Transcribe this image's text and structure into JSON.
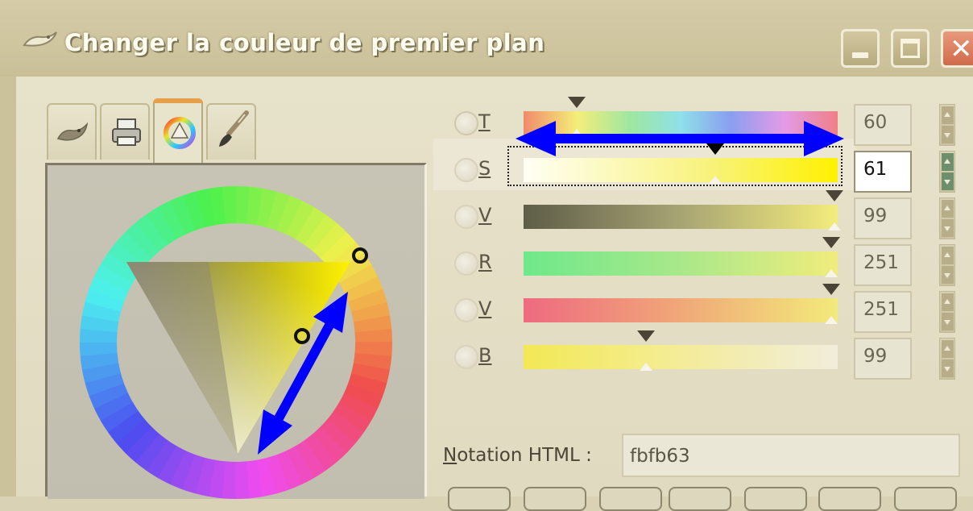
{
  "window": {
    "title": "Changer la couleur de premier plan",
    "controls": [
      "minimize",
      "maximize",
      "close"
    ]
  },
  "tabs": [
    {
      "name": "gimp",
      "icon": "wilber-icon"
    },
    {
      "name": "cmyk",
      "icon": "printer-icon"
    },
    {
      "name": "wheel",
      "icon": "color-triangle-icon",
      "active": true
    },
    {
      "name": "watercolor",
      "icon": "brush-icon"
    }
  ],
  "channels": [
    {
      "key": "h",
      "label": "T",
      "value": "60",
      "marker_fraction": 0.17
    },
    {
      "key": "s",
      "label": "S",
      "value": "61",
      "marker_fraction": 0.61,
      "active": true
    },
    {
      "key": "v",
      "label": "V",
      "value": "99",
      "marker_fraction": 0.99
    },
    {
      "key": "r",
      "label": "R",
      "value": "251",
      "marker_fraction": 0.98
    },
    {
      "key": "g",
      "label": "V",
      "value": "251",
      "marker_fraction": 0.98
    },
    {
      "key": "b",
      "label": "B",
      "value": "99",
      "marker_fraction": 0.39
    }
  ],
  "html_notation": {
    "label_first": "N",
    "label_rest": "otation HTML :",
    "value": "fbfb63"
  },
  "colors": {
    "current": "#fbfb63",
    "annotation_arrow": "#0000ff"
  }
}
